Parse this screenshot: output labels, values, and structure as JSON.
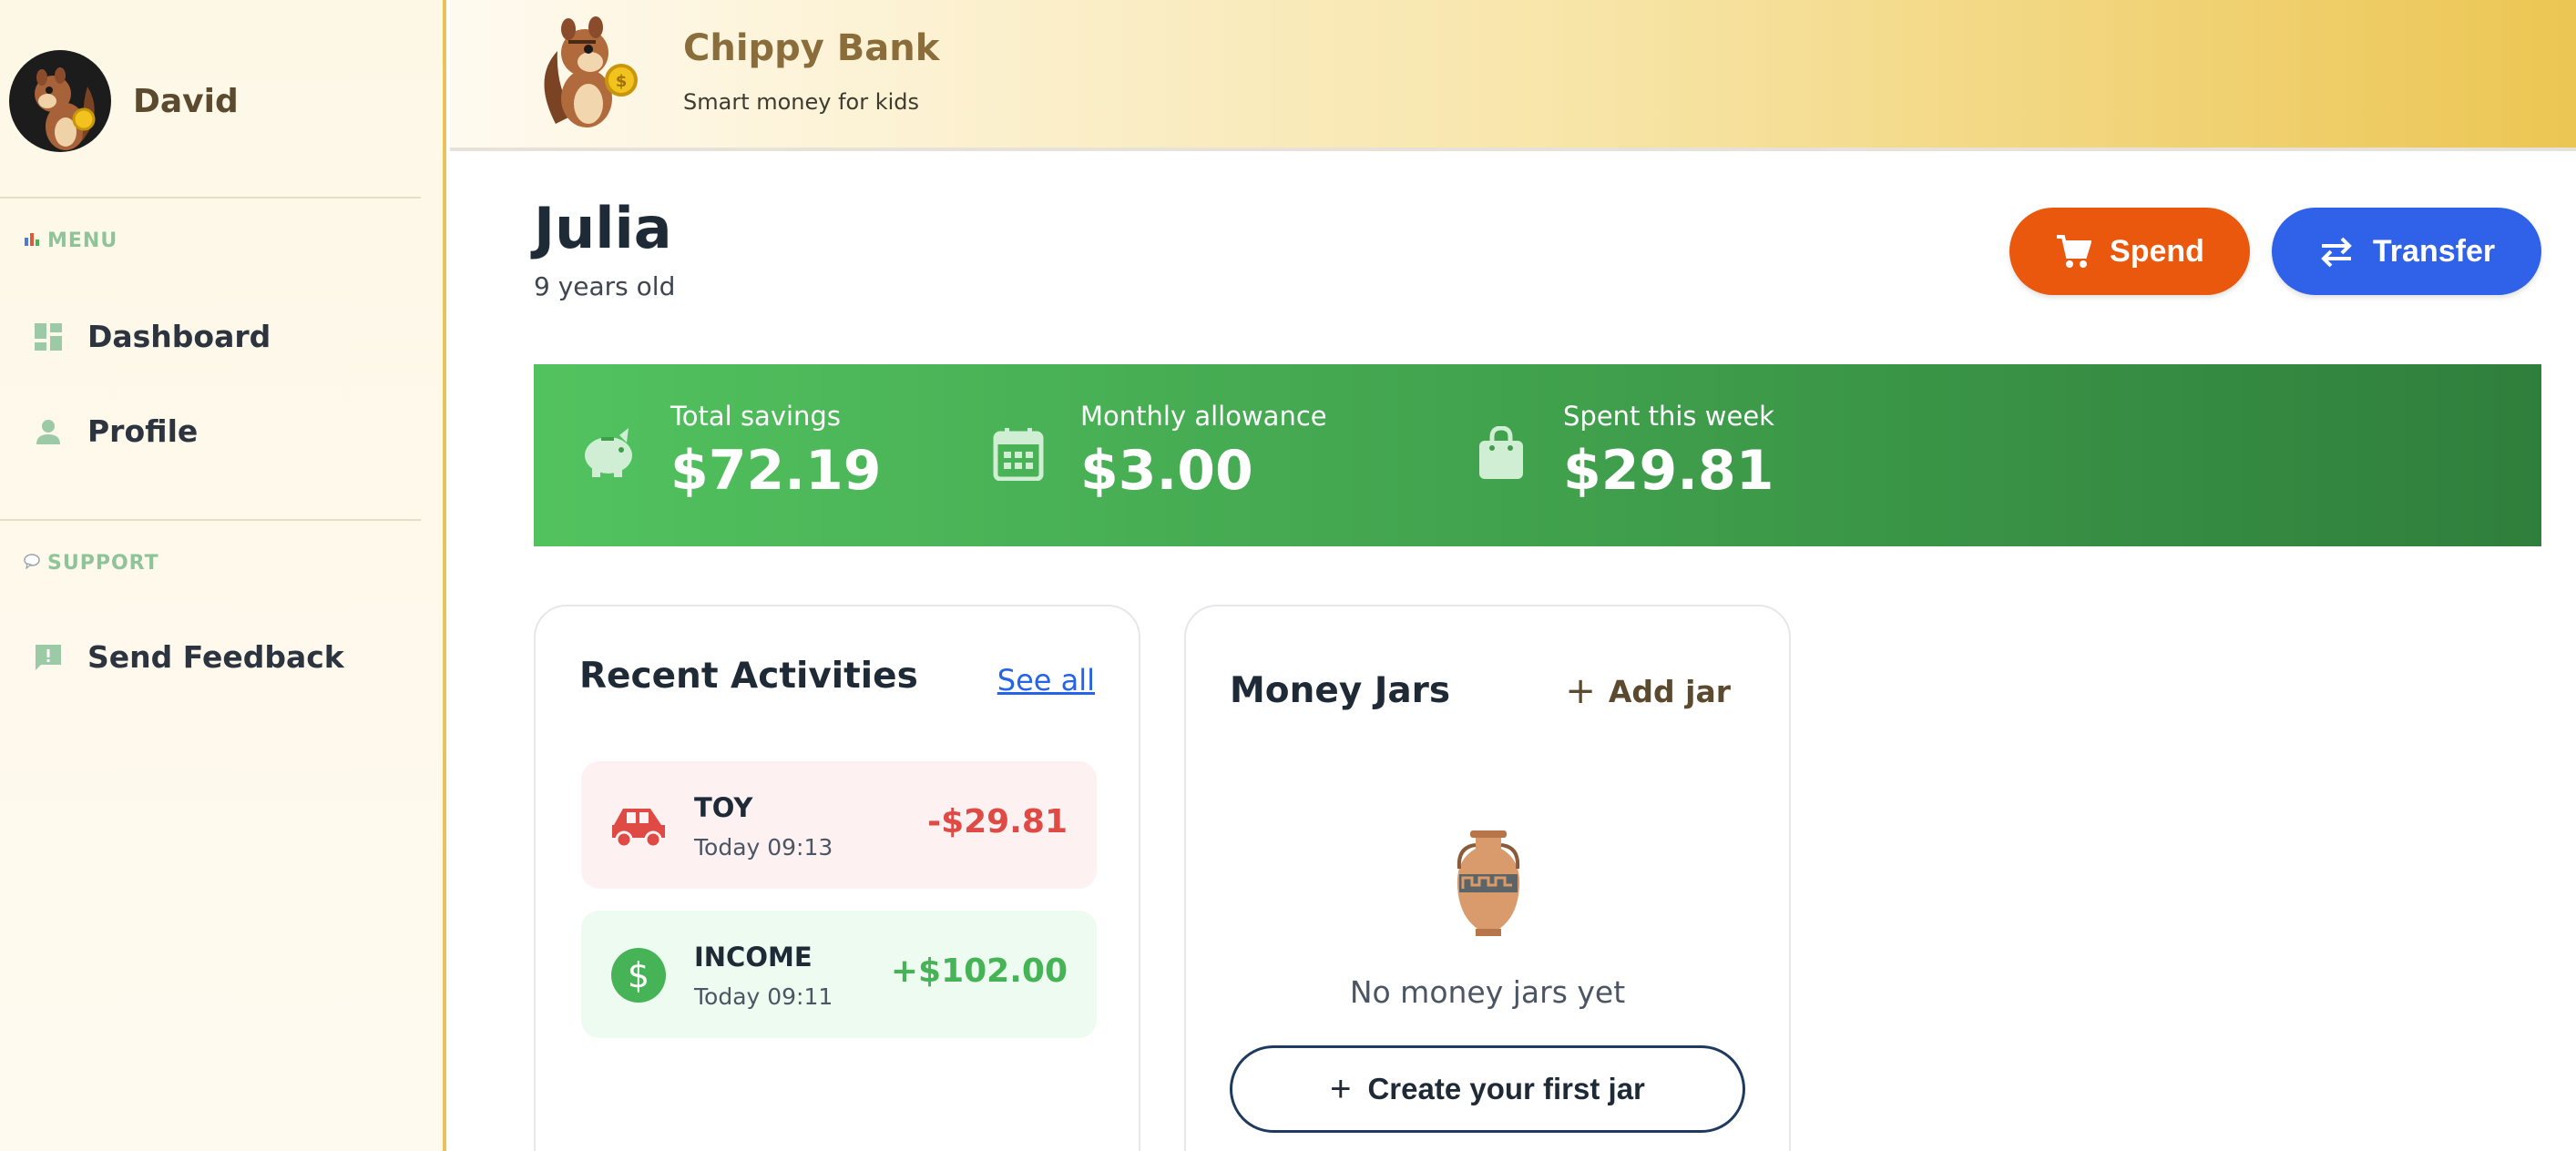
{
  "sidebar": {
    "user_name": "David",
    "menu_label": "MENU",
    "support_label": "SUPPORT",
    "items": [
      {
        "label": "Dashboard",
        "icon": "dashboard-icon"
      },
      {
        "label": "Profile",
        "icon": "person-icon"
      }
    ],
    "support_items": [
      {
        "label": "Send Feedback",
        "icon": "feedback-icon"
      }
    ]
  },
  "header": {
    "title": "Chippy Bank",
    "subtitle": "Smart money for kids"
  },
  "child": {
    "name": "Julia",
    "age": "9 years old"
  },
  "actions": {
    "spend_label": "Spend",
    "transfer_label": "Transfer"
  },
  "stats": [
    {
      "label": "Total savings",
      "value": "$72.19",
      "icon": "piggy-bank-icon"
    },
    {
      "label": "Monthly allowance",
      "value": "$3.00",
      "icon": "calendar-icon"
    },
    {
      "label": "Spent this week",
      "value": "$29.81",
      "icon": "shopping-bag-icon"
    }
  ],
  "recent": {
    "title": "Recent Activities",
    "see_all": "See all",
    "items": [
      {
        "title": "TOY",
        "time": "Today 09:13",
        "amount": "-$29.81",
        "icon": "car-icon"
      },
      {
        "title": "INCOME",
        "time": "Today 09:11",
        "amount": "+$102.00",
        "icon": "dollar-icon"
      }
    ]
  },
  "jars": {
    "title": "Money Jars",
    "add_label": "Add jar",
    "empty_text": "No money jars yet",
    "create_label": "Create your first jar"
  },
  "colors": {
    "spend": "#e9580c",
    "transfer": "#2f61e9",
    "stats_green": "#4caf50",
    "negative": "#e04a45",
    "positive": "#46b356",
    "accent_gold": "#e8c35a"
  }
}
